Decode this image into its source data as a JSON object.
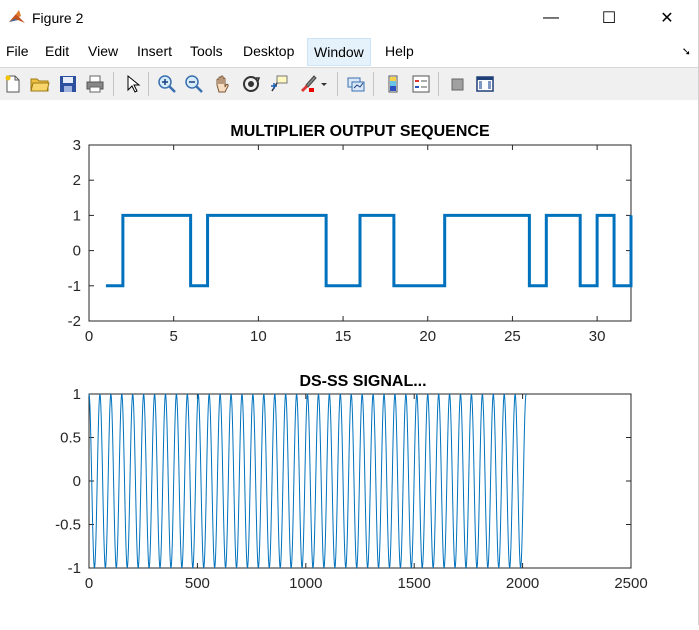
{
  "window": {
    "title": "Figure 2",
    "minimize": "—",
    "maximize": "☐",
    "close": "✕"
  },
  "menu": {
    "items": [
      {
        "label": "File",
        "x": 6
      },
      {
        "label": "Edit",
        "x": 45
      },
      {
        "label": "View",
        "x": 88
      },
      {
        "label": "Insert",
        "x": 137
      },
      {
        "label": "Tools",
        "x": 190
      },
      {
        "label": "Desktop",
        "x": 243
      },
      {
        "label": "Window",
        "x": 308,
        "active": true
      },
      {
        "label": "Help",
        "x": 385
      }
    ]
  },
  "toolbar": {
    "icons": [
      "new-figure-icon",
      "open-file-icon",
      "save-icon",
      "print-icon",
      "select-arrow-icon",
      "zoom-in-icon",
      "zoom-out-icon",
      "pan-hand-icon",
      "rotate-3d-icon",
      "data-cursor-icon",
      "brush-icon",
      "brush-dropdown-icon",
      "link-plot-icon",
      "insert-colorbar-icon",
      "insert-legend-icon",
      "hide-plot-tools-icon",
      "show-plot-tools-icon"
    ]
  },
  "colors": {
    "line": "#0072bd",
    "axis": "#262626",
    "grid": "#262626"
  },
  "chart_data": [
    {
      "type": "line",
      "title": "MULTIPLIER OUTPUT SEQUENCE",
      "xlabel": "",
      "ylabel": "",
      "xlim": [
        0,
        32
      ],
      "ylim": [
        -2,
        3
      ],
      "xticks": [
        0,
        5,
        10,
        15,
        20,
        25,
        30
      ],
      "yticks": [
        -2,
        -1,
        0,
        1,
        2,
        3
      ],
      "step": true,
      "x": [
        1,
        2,
        3,
        4,
        5,
        6,
        7,
        8,
        9,
        10,
        11,
        12,
        13,
        14,
        15,
        16,
        17,
        18,
        19,
        20,
        21,
        22,
        23,
        24,
        25,
        26,
        27,
        28,
        29,
        30,
        31,
        32
      ],
      "values": [
        -1,
        1,
        1,
        1,
        1,
        -1,
        1,
        1,
        1,
        1,
        1,
        1,
        1,
        -1,
        -1,
        1,
        1,
        -1,
        -1,
        -1,
        1,
        1,
        1,
        1,
        1,
        -1,
        1,
        1,
        -1,
        1,
        -1,
        1
      ]
    },
    {
      "type": "line",
      "title": "DS-SS SIGNAL...",
      "xlabel": "",
      "ylabel": "",
      "xlim": [
        0,
        2500
      ],
      "ylim": [
        -1,
        1
      ],
      "xticks": [
        0,
        500,
        1000,
        1500,
        2000,
        2500
      ],
      "yticks": [
        -1,
        -0.5,
        0,
        0.5,
        1
      ],
      "sample_count": 2016,
      "cycles": 40
    }
  ]
}
